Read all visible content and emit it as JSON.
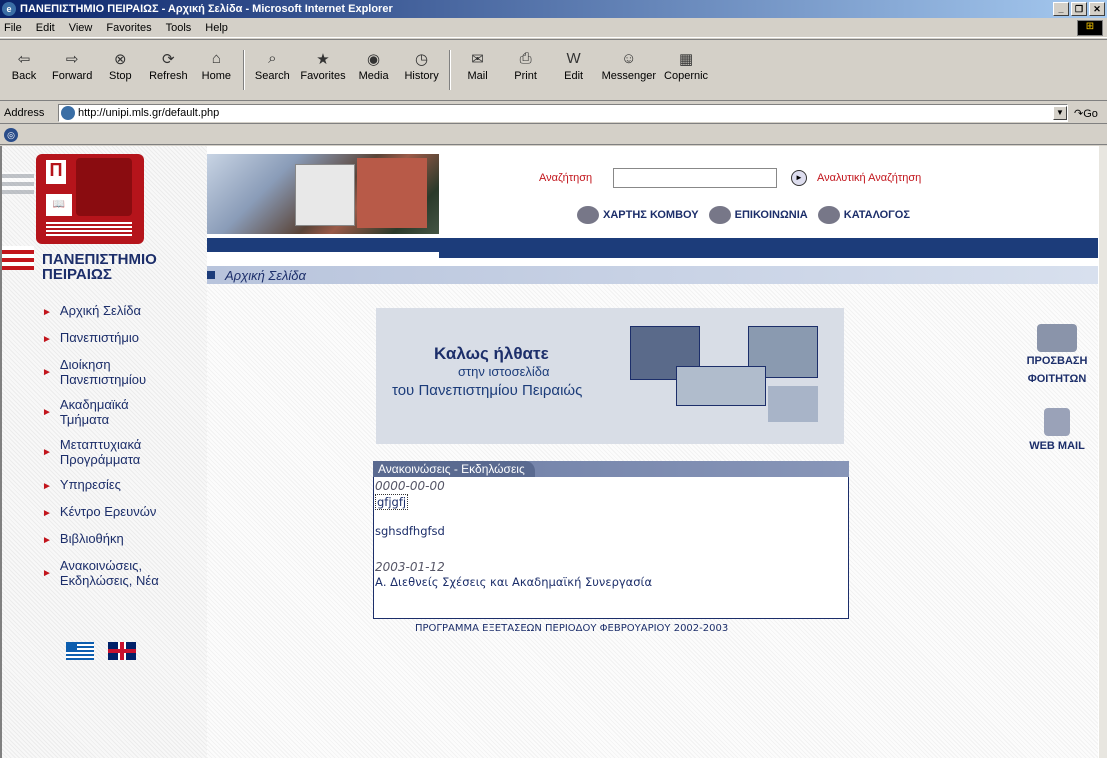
{
  "window": {
    "title": "ΠΑΝΕΠΙΣΤΗΜΙΟ ΠΕΙΡΑΙΩΣ - Αρχική Σελίδα - Microsoft Internet Explorer"
  },
  "menu": [
    "File",
    "Edit",
    "View",
    "Favorites",
    "Tools",
    "Help"
  ],
  "toolbar": [
    {
      "label": "Back",
      "icon": "back-arrow-icon"
    },
    {
      "label": "Forward",
      "icon": "forward-arrow-icon"
    },
    {
      "label": "Stop",
      "icon": "stop-icon"
    },
    {
      "label": "Refresh",
      "icon": "refresh-icon"
    },
    {
      "label": "Home",
      "icon": "home-icon"
    },
    {
      "label": "Search",
      "icon": "search-icon"
    },
    {
      "label": "Favorites",
      "icon": "favorites-icon"
    },
    {
      "label": "Media",
      "icon": "media-icon"
    },
    {
      "label": "History",
      "icon": "history-icon"
    },
    {
      "label": "Mail",
      "icon": "mail-icon"
    },
    {
      "label": "Print",
      "icon": "print-icon"
    },
    {
      "label": "Edit",
      "icon": "edit-icon"
    },
    {
      "label": "Messenger",
      "icon": "messenger-icon"
    },
    {
      "label": "Copernic",
      "icon": "copernic-icon"
    }
  ],
  "address": {
    "label": "Address",
    "url": "http://unipi.mls.gr/default.php",
    "go": "Go"
  },
  "site": {
    "university_name": [
      "ΠΑΝΕΠΙΣΤΗΜΙΟ",
      "ΠΕΙΡΑΙΩΣ"
    ],
    "search_label": "Αναζήτηση",
    "search_value": "",
    "advanced_search": "Αναλυτική Αναζήτηση",
    "top_links": [
      "ΧΑΡΤΗΣ ΚΟΜΒΟΥ",
      "ΕΠΙΚΟΙΝΩΝΙΑ",
      "ΚΑΤΑΛΟΓΟΣ"
    ],
    "breadcrumb": "Αρχική Σελίδα",
    "nav": [
      "Αρχική Σελίδα",
      "Πανεπιστήμιο",
      "Διοίκηση Πανεπιστημίου",
      "Ακαδημαϊκά Τμήματα",
      "Μεταπτυχιακά Προγράμματα",
      "Υπηρεσίες",
      "Κέντρο Ερευνών",
      "Βιβλιοθήκη",
      "Ανακοινώσεις, Εκδηλώσεις, Νέα"
    ],
    "welcome": {
      "line1": "Καλως ήλθατε",
      "line2": "στην ιστοσελίδα",
      "line3_prefix": "του ",
      "line3_name": "Πανεπιστημίου Πειραιώς"
    },
    "news": {
      "header": "Ανακοινώσεις - Εκδηλώσεις",
      "items": [
        {
          "date": "0000-00-00",
          "title": "gfjgfj",
          "body": "sghsdfhgfsd"
        },
        {
          "date": "2003-01-12",
          "title": "Α. Διεθνείς Σχέσεις και Ακαδημαϊκή Συνεργασία"
        }
      ],
      "footer": "ΠΡΟΓΡΑΜΜΑ ΕΞΕΤΑΣΕΩΝ ΠΕΡΙΟΔΟΥ ΦΕΒΡΟΥΑΡΙΟΥ 2002-2003"
    },
    "right_links": [
      {
        "label_lines": [
          "ΠΡΟΣΒΑΣΗ",
          "ΦΟΙΤΗΤΩΝ"
        ]
      },
      {
        "label_lines": [
          "WEB MAIL"
        ]
      }
    ]
  },
  "colors": {
    "brand_blue": "#1c2e6a",
    "brand_red": "#c2151c"
  }
}
